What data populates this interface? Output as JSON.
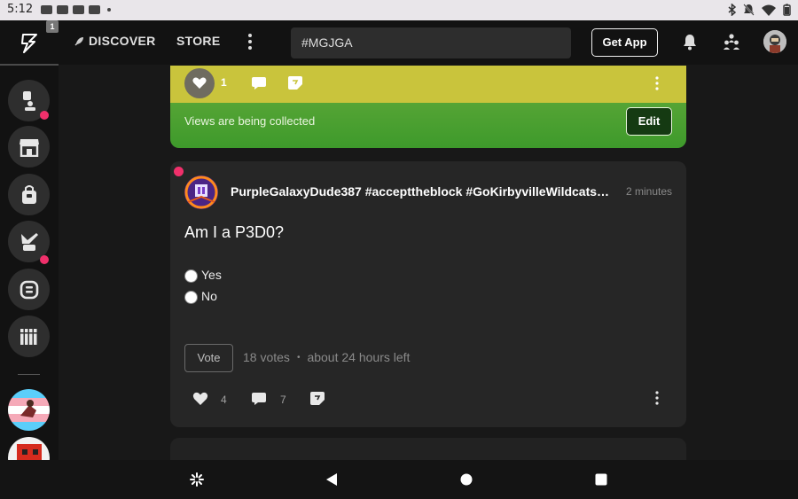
{
  "status_bar": {
    "time": "5:12"
  },
  "header": {
    "logo_badge": "1",
    "discover_label": "DISCOVER",
    "store_label": "STORE",
    "search_value": "#MGJGA",
    "get_app_label": "Get App"
  },
  "colors": {
    "accent_pink": "#f0306b",
    "card_yellow": "#c9c43c",
    "card_green": "#4aa030",
    "card_bg": "#262626",
    "page_bg": "#181818"
  },
  "feed": {
    "previous_post": {
      "like_count": "1",
      "views_text": "Views are being collected",
      "edit_label": "Edit"
    },
    "poll_post": {
      "author": "PurpleGalaxyDude387 #accepttheblock #GoKirbyvilleWildcats #AE",
      "time": "2 minutes",
      "title": "Am I a P3D0?",
      "options": [
        "Yes",
        "No"
      ],
      "vote_label": "Vote",
      "votes": "18 votes",
      "time_left": "about 24 hours left",
      "like_count": "4",
      "comment_count": "7"
    }
  }
}
